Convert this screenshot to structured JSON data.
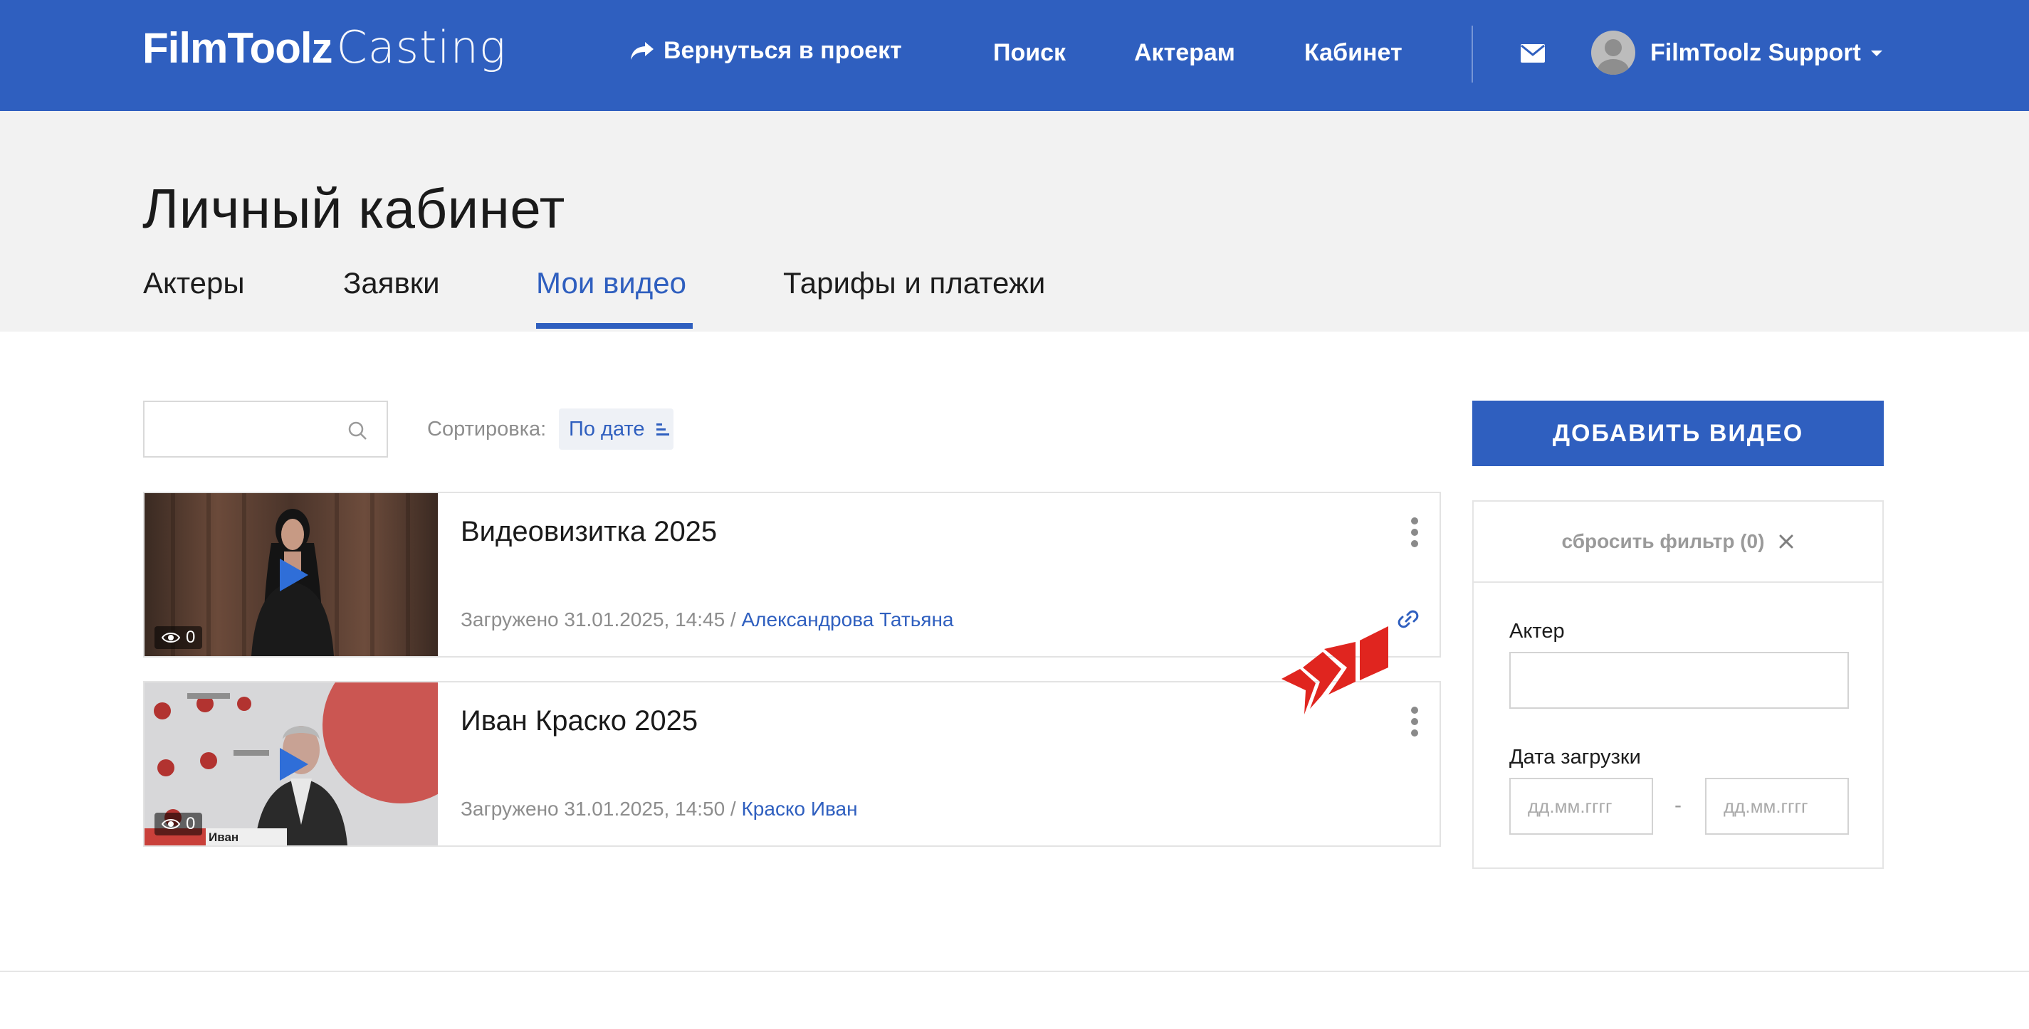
{
  "header": {
    "logo_bold": "FilmToolz",
    "logo_light": "Casting",
    "back_label": "Вернуться в проект",
    "nav": [
      {
        "label": "Поиск"
      },
      {
        "label": "Актерам"
      },
      {
        "label": "Кабинет"
      }
    ],
    "user_name": "FilmToolz Support",
    "icons": {
      "back": "share-arrow-icon",
      "mail": "envelope-icon",
      "caret": "caret-down-icon"
    }
  },
  "page": {
    "title": "Личный кабинет",
    "tabs": [
      {
        "label": "Актеры"
      },
      {
        "label": "Заявки"
      },
      {
        "label": "Мои видео",
        "active": true
      },
      {
        "label": "Тарифы и платежи"
      }
    ]
  },
  "toolbar": {
    "search_placeholder": "",
    "search_value": "",
    "sort_label": "Сортировка:",
    "sort_value": "По дате"
  },
  "videos": [
    {
      "title": "Видеовизитка 2025",
      "uploaded": "Загружено 31.01.2025, 14:45 / ",
      "actor": "Александрова Татьяна",
      "views": "0",
      "has_link_icon": true
    },
    {
      "title": "Иван Краско 2025",
      "uploaded": "Загружено 31.01.2025, 14:50 / ",
      "actor": "Краско Иван",
      "views": "0",
      "thumb_caption": "Иван",
      "has_link_icon": false
    }
  ],
  "sidebar": {
    "add_button": "ДОБАВИТЬ ВИДЕО",
    "reset_filter": "сбросить фильтр (0)",
    "actor_label": "Актер",
    "actor_value": "",
    "date_label": "Дата загрузки",
    "date_from_placeholder": "дд.мм.гггг",
    "date_to_placeholder": "дд.мм.гггг",
    "date_separator": "-"
  },
  "colors": {
    "brand_blue": "#2f5fbf",
    "page_header_bg": "#f2f2f2",
    "muted_text": "#8d8d8d",
    "overlay_red": "#e0251f"
  }
}
